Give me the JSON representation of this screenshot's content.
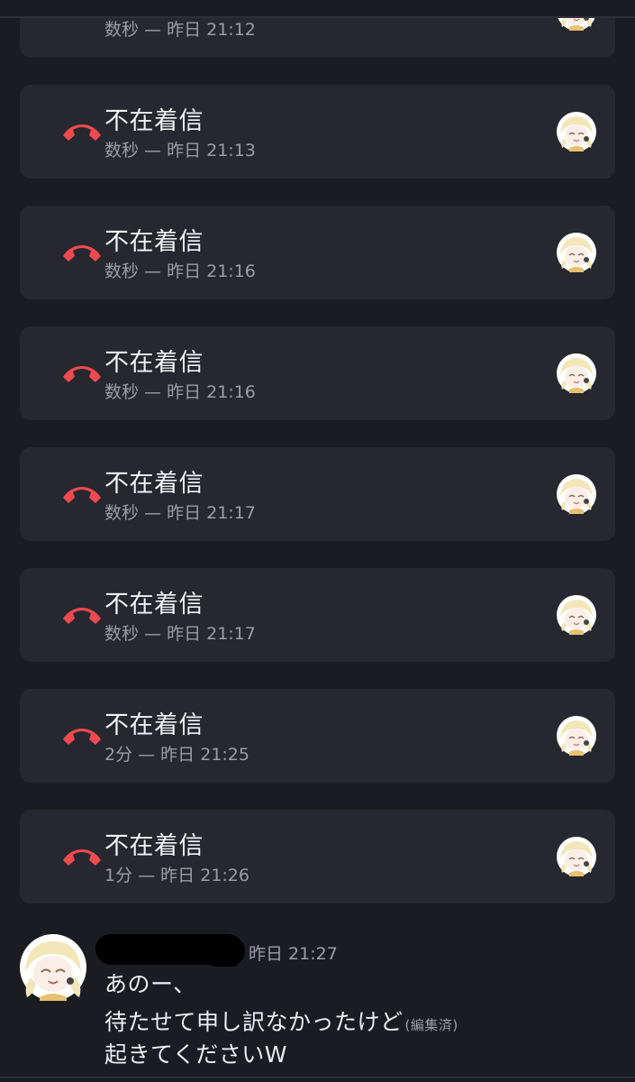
{
  "colors": {
    "background": "#1b1c21",
    "card": "#26272f",
    "missed_red": "#f04a4f",
    "muted": "#9b9ea6",
    "text": "#f2f3f5"
  },
  "calls": [
    {
      "title": "",
      "subtitle": "数秒 — 昨日 21:12",
      "icon": "missed-call-icon"
    },
    {
      "title": "不在着信",
      "subtitle": "数秒 — 昨日 21:13",
      "icon": "missed-call-icon"
    },
    {
      "title": "不在着信",
      "subtitle": "数秒 — 昨日 21:16",
      "icon": "missed-call-icon"
    },
    {
      "title": "不在着信",
      "subtitle": "数秒 — 昨日 21:16",
      "icon": "missed-call-icon"
    },
    {
      "title": "不在着信",
      "subtitle": "数秒 — 昨日 21:17",
      "icon": "missed-call-icon"
    },
    {
      "title": "不在着信",
      "subtitle": "数秒 — 昨日 21:17",
      "icon": "missed-call-icon"
    },
    {
      "title": "不在着信",
      "subtitle": "2分 — 昨日 21:25",
      "icon": "missed-call-icon"
    },
    {
      "title": "不在着信",
      "subtitle": "1分 — 昨日 21:26",
      "icon": "missed-call-icon"
    }
  ],
  "message": {
    "timestamp": "昨日 21:27",
    "lines": [
      "あのー、",
      "待たせて申し訳なかったけど",
      "起きてくださいW"
    ],
    "edited_label": "(編集済)"
  }
}
